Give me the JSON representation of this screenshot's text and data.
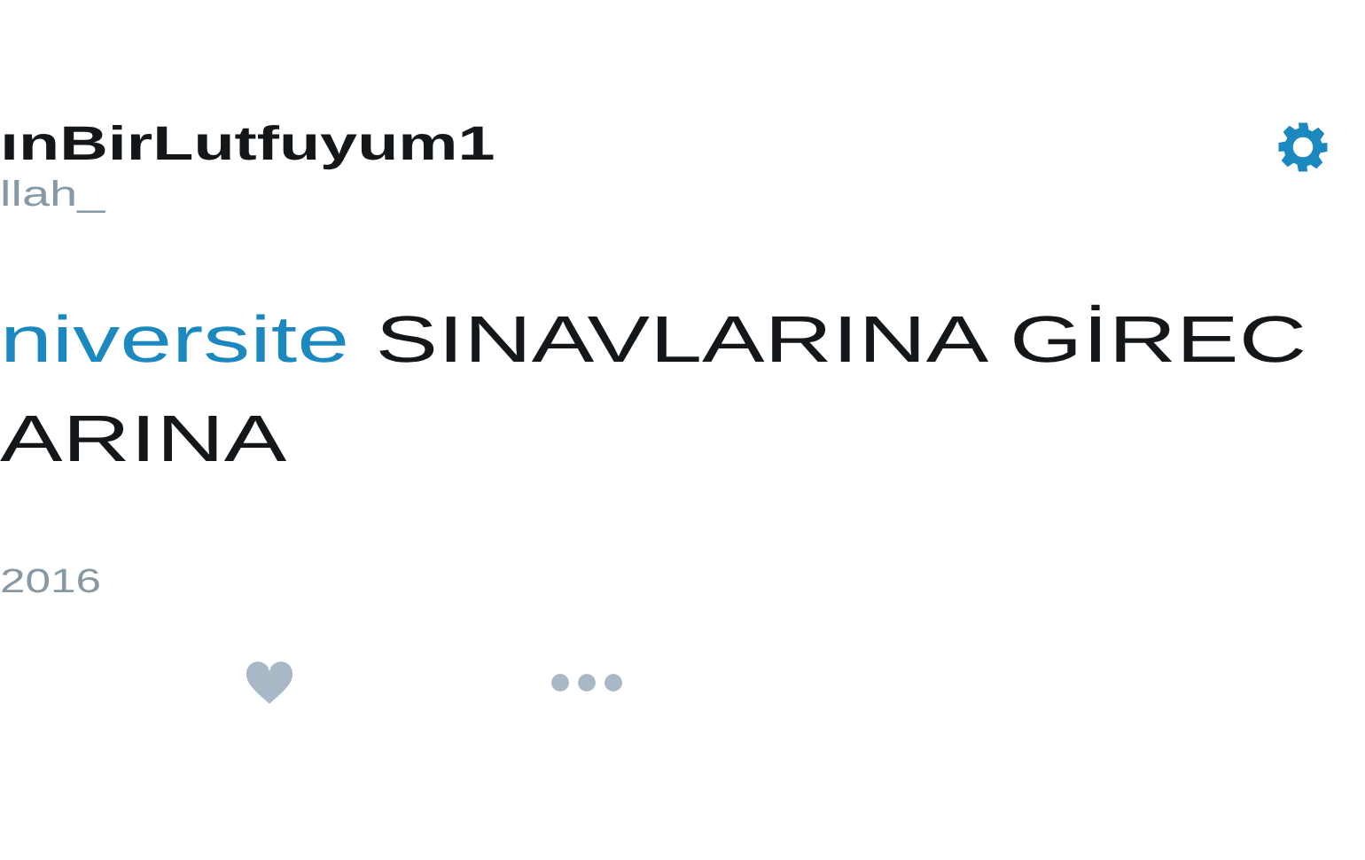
{
  "author": {
    "name": "ınBirLutfuyum1",
    "handle": "llah_"
  },
  "tweet": {
    "hashtag": "niversite",
    "lines": [
      " SINAVLARINA GİREC",
      "ARINA"
    ]
  },
  "date": "2016",
  "actions": [
    {
      "kind": "like"
    },
    {
      "kind": "more"
    }
  ]
}
